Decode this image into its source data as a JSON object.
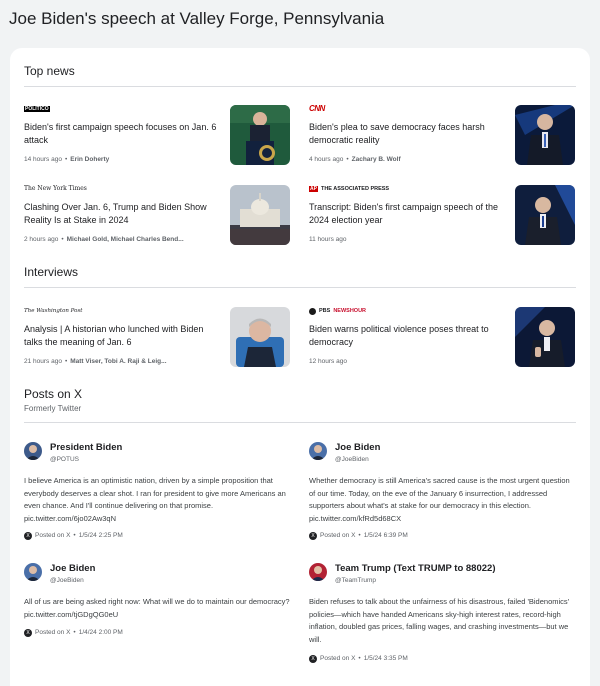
{
  "page": {
    "title": "Joe Biden's speech at Valley Forge, Pennsylvania"
  },
  "top_news": {
    "title": "Top news",
    "items": [
      {
        "source": "POLITICO",
        "headline": "Biden's first campaign speech focuses on Jan. 6 attack",
        "time": "14 hours ago",
        "authors": "Erin Doherty"
      },
      {
        "source": "CNN",
        "headline": "Biden's plea to save democracy faces harsh democratic reality",
        "time": "4 hours ago",
        "authors": "Zachary B. Wolf"
      },
      {
        "source": "The New York Times",
        "headline": "Clashing Over Jan. 6, Trump and Biden Show Reality Is at Stake in 2024",
        "time": "2 hours ago",
        "authors": "Michael Gold, Michael Charles Bend..."
      },
      {
        "source": "THE ASSOCIATED PRESS",
        "source_mark": "AP",
        "headline": "Transcript: Biden's first campaign speech of the 2024 election year",
        "time": "11 hours ago",
        "authors": ""
      }
    ]
  },
  "interviews": {
    "title": "Interviews",
    "items": [
      {
        "source": "The Washington Post",
        "headline": "Analysis | A historian who lunched with Biden talks the meaning of Jan. 6",
        "time": "21 hours ago",
        "authors": "Matt Viser, Tobi A. Raji & Leig..."
      },
      {
        "source_a": "PBS",
        "source_b": "NEWSHOUR",
        "headline": "Biden warns political violence poses threat to democracy",
        "time": "12 hours ago",
        "authors": ""
      }
    ]
  },
  "posts": {
    "title": "Posts on X",
    "subtitle": "Formerly Twitter",
    "posted_label": "Posted on X",
    "x_glyph": "X",
    "items": [
      {
        "name": "President Biden",
        "handle": "@POTUS",
        "text": "I believe America is an optimistic nation, driven by a simple proposition that everybody deserves a clear shot. I ran for president to give more Americans an even chance. And I'll continue delivering on that promise. pic.twitter.com/6jo02Aw3qN",
        "date": "1/5/24 2:25 PM"
      },
      {
        "name": "Joe Biden",
        "handle": "@JoeBiden",
        "text": "Whether democracy is still America's sacred cause is the most urgent question of our time. Today, on the eve of the January 6 insurrection, I addressed supporters about what's at stake for our democracy in this election. pic.twitter.com/kfRd5d68CX",
        "date": "1/5/24 6:39 PM"
      },
      {
        "name": "Joe Biden",
        "handle": "@JoeBiden",
        "text": "All of us are being asked right now: What will we do to maintain our democracy? pic.twitter.com/tjGDgQG0eU",
        "date": "1/4/24 2:00 PM"
      },
      {
        "name": "Team Trump (Text TRUMP to 88022)",
        "handle": "@TeamTrump",
        "text": "Biden refuses to talk about the unfairness of his disastrous, failed 'Bidenomics' policies—which have handed Americans sky-high interest rates, record-high inflation, doubled gas prices, falling wages, and crashing investments—but we will.",
        "date": "1/5/24 3:35 PM"
      }
    ]
  },
  "separator": "•",
  "colors": {
    "background": "#f1f3f4",
    "card": "#ffffff",
    "divider": "#dadce0",
    "muted_text": "#5f6368",
    "cnn_red": "#cc0000"
  }
}
